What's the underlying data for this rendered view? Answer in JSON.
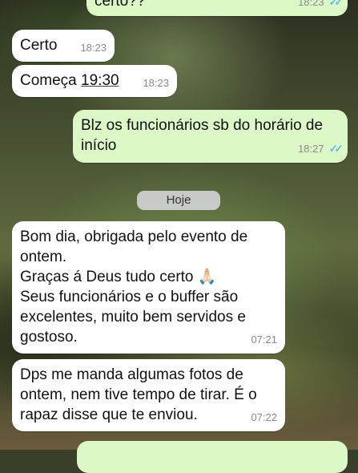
{
  "colors": {
    "incoming_bubble": "#ffffff",
    "outgoing_bubble": "#dcf8c6",
    "read_ticks": "#34b7f1",
    "timestamp": "#8a8a8a"
  },
  "messages": [
    {
      "text": "certo??",
      "time": "18:23",
      "direction": "outgoing",
      "status": "read"
    },
    {
      "text": "Certo",
      "time": "18:23",
      "direction": "incoming"
    },
    {
      "text_prefix": "Começa ",
      "text_link": "19:30",
      "time": "18:23",
      "direction": "incoming"
    },
    {
      "text": "Blz os funcionários sb do horário de início",
      "time": "18:27",
      "direction": "outgoing",
      "status": "read"
    },
    {
      "text": "Bom dia, obrigada pelo evento de ontem.\nGraças á Deus tudo certo 🙏🏻\nSeus funcionários e o buffer são excelentes, muito bem servidos e gostoso.",
      "time": "07:21",
      "direction": "incoming"
    },
    {
      "text": "Dps me manda algumas fotos de ontem, nem tive tempo de tirar. É o rapaz disse que te enviou.",
      "time": "07:22",
      "direction": "incoming"
    }
  ],
  "date_divider": "Hoje",
  "read_ticks_icon": "double-check-icon"
}
